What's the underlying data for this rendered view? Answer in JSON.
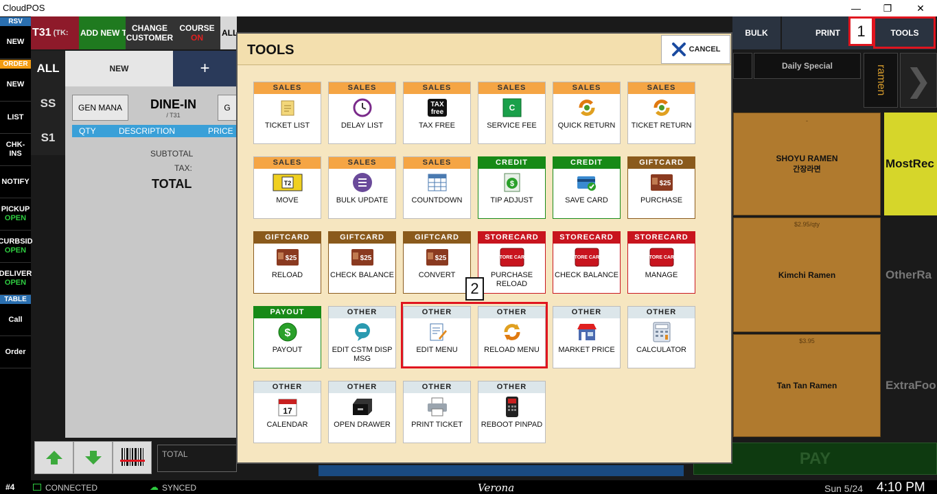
{
  "window": {
    "title": "CloudPOS"
  },
  "colors": {
    "accent_red": "#e0141e",
    "sales": "#f5a544",
    "credit": "#178a17",
    "giftcard": "#8a5a1c",
    "storecard": "#c8141e",
    "other": "#dce6ea"
  },
  "left_nav": {
    "rsv": "RSV",
    "new1": "NEW",
    "order": "ORDER",
    "new2": "NEW",
    "list": "LIST",
    "chkins": "CHK-INS",
    "notify": "NOTIFY",
    "pickup": "PICKUP",
    "pickup_status": "OPEN",
    "curbside": "CURBSID",
    "curbside_status": "OPEN",
    "delivery": "DELIVER",
    "delivery_status": "OPEN",
    "table": "TABLE",
    "call": "Call",
    "orderitem": "Order"
  },
  "top_bar": {
    "table_id": "T31",
    "table_tk": "(TK:",
    "add_new": "ADD NEW T",
    "change_customer": "CHANGE CUSTOMER",
    "course": "COURSE",
    "course_status": "ON",
    "all": "ALL",
    "bulk": "BULK",
    "print": "PRINT",
    "tools": "TOOLS"
  },
  "order_panel": {
    "all_tab": "ALL",
    "new_tab": "NEW",
    "add_tab": "+",
    "seat_ss": "SS",
    "seat_s1": "S1",
    "gen_mana": "GEN MANA",
    "dine_in": "DINE-IN",
    "dine_sub": "/ T31",
    "g_btn": "G",
    "col_qty": "QTY",
    "col_desc": "DESCRIPTION",
    "col_price": "PRICE",
    "subtotal": "SUBTOTAL",
    "tax": "TAX:",
    "total": "TOTAL",
    "total_field": "TOTAL"
  },
  "menu": {
    "daily_special": "Daily Special",
    "ramen_tab": "ramen",
    "items": [
      {
        "name": "SHOYU RAMEN",
        "sub": "간장라면",
        "price": "-"
      },
      {
        "name": "Kimchi Ramen",
        "sub": "",
        "price": "$2.95/qty"
      },
      {
        "name": "Tan Tan Ramen",
        "sub": "",
        "price": "$3.95"
      }
    ],
    "categories": [
      "MostRec",
      "OtherRa",
      "ExtraFoo"
    ],
    "pay": "PAY"
  },
  "status_bar": {
    "station": "#4",
    "connected": "CONNECTED",
    "synced": "SYNCED",
    "brand": "Verona",
    "date": "Sun 5/24",
    "time": "4:10 PM"
  },
  "modal": {
    "title": "TOOLS",
    "cancel": "CANCEL",
    "tiles": [
      {
        "cat": "SALES",
        "label": "TICKET LIST",
        "icon": "notepad-icon"
      },
      {
        "cat": "SALES",
        "label": "DELAY LIST",
        "icon": "clock-icon"
      },
      {
        "cat": "SALES",
        "label": "TAX FREE",
        "icon": "tax-free-icon"
      },
      {
        "cat": "SALES",
        "label": "SERVICE FEE",
        "icon": "service-fee-icon"
      },
      {
        "cat": "SALES",
        "label": "QUICK RETURN",
        "icon": "return-icon"
      },
      {
        "cat": "SALES",
        "label": "TICKET RETURN",
        "icon": "return-icon"
      },
      {
        "cat": "SALES",
        "label": "MOVE",
        "icon": "move-icon"
      },
      {
        "cat": "SALES",
        "label": "BULK UPDATE",
        "icon": "list-icon"
      },
      {
        "cat": "SALES",
        "label": "COUNTDOWN",
        "icon": "table-icon"
      },
      {
        "cat": "CREDIT",
        "label": "TIP ADJUST",
        "icon": "money-icon"
      },
      {
        "cat": "CREDIT",
        "label": "SAVE CARD",
        "icon": "card-icon"
      },
      {
        "cat": "GIFTCARD",
        "label": "PURCHASE",
        "icon": "gift-card-icon"
      },
      {
        "cat": "GIFTCARD",
        "label": "RELOAD",
        "icon": "gift-card-icon"
      },
      {
        "cat": "GIFTCARD",
        "label": "CHECK BALANCE",
        "icon": "gift-card-icon"
      },
      {
        "cat": "GIFTCARD",
        "label": "CONVERT",
        "icon": "gift-card-icon"
      },
      {
        "cat": "STORECARD",
        "label": "PURCHASE RELOAD",
        "icon": "store-card-icon"
      },
      {
        "cat": "STORECARD",
        "label": "CHECK BALANCE",
        "icon": "store-card-icon"
      },
      {
        "cat": "STORECARD",
        "label": "MANAGE",
        "icon": "store-card-icon"
      },
      {
        "cat": "PAYOUT",
        "label": "PAYOUT",
        "icon": "dollar-icon"
      },
      {
        "cat": "OTHER",
        "label": "EDIT CSTM DISP MSG",
        "icon": "chat-icon"
      },
      {
        "cat": "OTHER",
        "label": "EDIT MENU",
        "icon": "edit-icon"
      },
      {
        "cat": "OTHER",
        "label": "RELOAD MENU",
        "icon": "reload-icon"
      },
      {
        "cat": "OTHER",
        "label": "MARKET PRICE",
        "icon": "store-icon"
      },
      {
        "cat": "OTHER",
        "label": "CALCULATOR",
        "icon": "calculator-icon"
      },
      {
        "cat": "OTHER",
        "label": "CALENDAR",
        "icon": "calendar-icon"
      },
      {
        "cat": "OTHER",
        "label": "OPEN DRAWER",
        "icon": "drawer-icon"
      },
      {
        "cat": "OTHER",
        "label": "PRINT TICKET",
        "icon": "printer-icon"
      },
      {
        "cat": "OTHER",
        "label": "REBOOT PINPAD",
        "icon": "pinpad-icon"
      }
    ],
    "icon_text": {
      "tax_top": "TAX",
      "tax_bottom": "free",
      "fee": "C",
      "move": "T2",
      "gift": "$25",
      "store": "STORE CARD",
      "calendar": "17"
    }
  },
  "annotations": {
    "step1": "1",
    "step2": "2"
  }
}
